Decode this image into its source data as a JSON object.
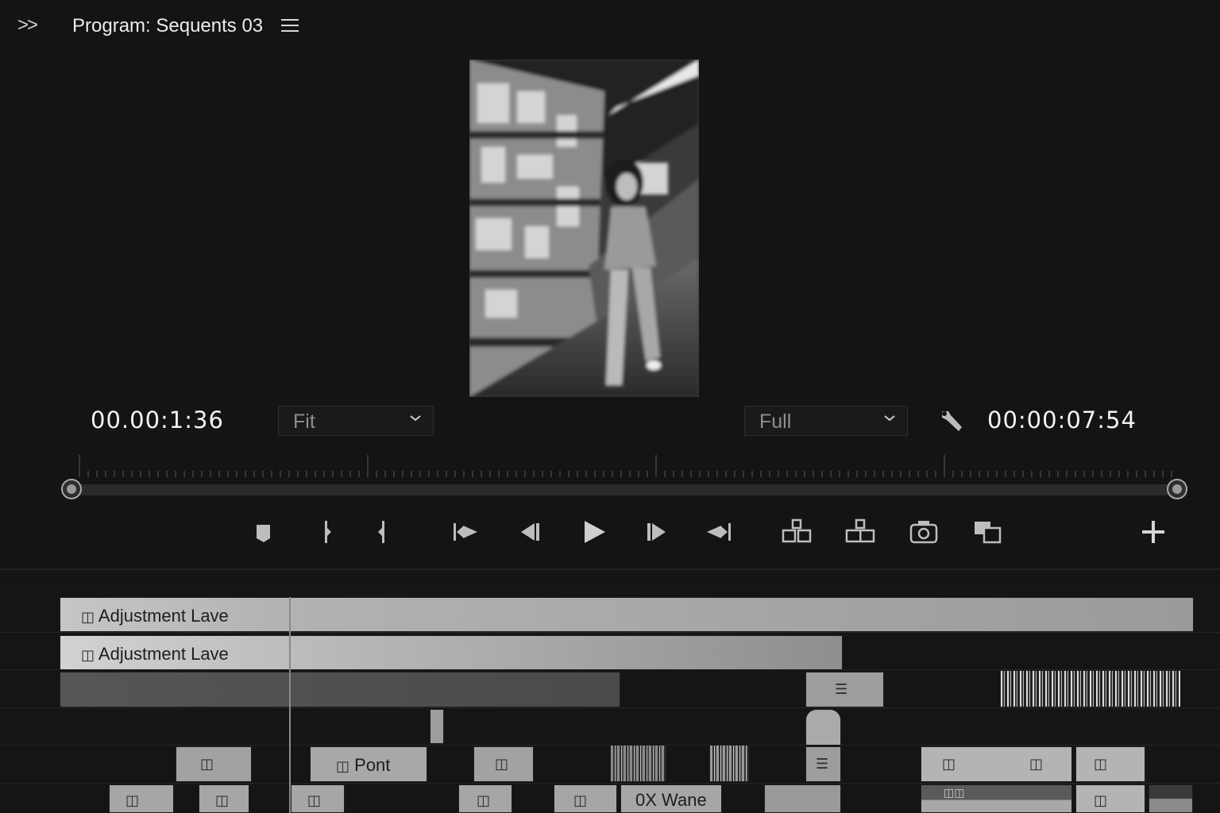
{
  "header": {
    "expand_label": ">>",
    "title": "Program: Sequents 03"
  },
  "monitor": {
    "timecode_current": "00.00:1:36",
    "timecode_duration": "00:00:07:54",
    "zoom_dropdown": "Fit",
    "resolution_dropdown": "Full"
  },
  "transport": {
    "icons": [
      "marker-icon",
      "mark-in-icon",
      "mark-out-icon",
      "go-to-in-icon",
      "step-back-icon",
      "play-icon",
      "step-forward-icon",
      "go-to-out-icon",
      "insert-icon",
      "overwrite-icon",
      "export-frame-icon",
      "comparison-view-icon",
      "add-button-icon"
    ]
  },
  "timeline": {
    "adjustment_layer_1": "Adjustment Lave",
    "adjustment_layer_2": "Adjustment Lave",
    "clip_pont": "Pont",
    "clip_wane": "0X Wane"
  },
  "colors": {
    "background": "#141414",
    "clip_light": "#b8b8b8",
    "clip_dark": "#555555",
    "text": "#e6e6e6"
  }
}
